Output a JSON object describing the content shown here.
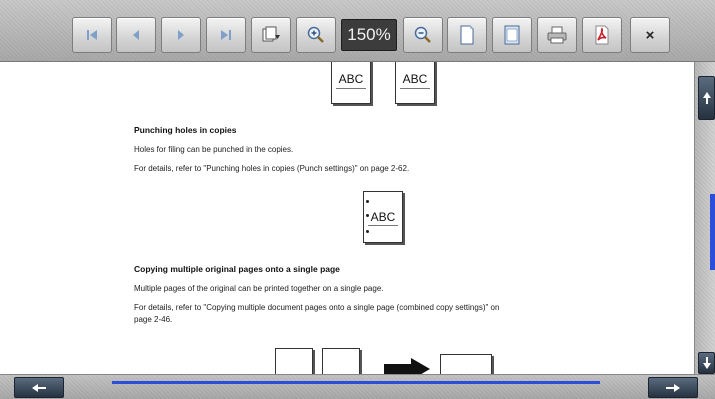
{
  "toolbar": {
    "buttons": [
      {
        "name": "first-page",
        "icon": "first-page-icon"
      },
      {
        "name": "previous-page",
        "icon": "previous-page-icon"
      },
      {
        "name": "next-page",
        "icon": "next-page-icon"
      },
      {
        "name": "last-page",
        "icon": "last-page-icon"
      },
      {
        "name": "page-select",
        "icon": "page-select-icon"
      },
      {
        "name": "zoom-in",
        "icon": "zoom-in-icon"
      },
      {
        "name": "zoom-out",
        "icon": "zoom-out-icon"
      },
      {
        "name": "fit-page",
        "icon": "fit-page-icon"
      },
      {
        "name": "fit-width",
        "icon": "fit-width-icon"
      },
      {
        "name": "print",
        "icon": "printer-icon"
      },
      {
        "name": "pdf",
        "icon": "pdf-icon"
      },
      {
        "name": "close",
        "icon": "close-icon"
      }
    ],
    "zoom_level": "150%",
    "close_label": "×"
  },
  "document": {
    "top_figure": {
      "left_box": "ABC",
      "right_box": "ABC"
    },
    "section1": {
      "heading": "Punching holes in copies",
      "line1": "Holes for filing can be punched in the copies.",
      "line2": "For details, refer to \"Punching holes in copies (Punch settings)\" on page 2-62.",
      "figure_text": "ABC"
    },
    "section2": {
      "heading": "Copying multiple original pages onto a single page",
      "line1": "Multiple pages of the original can be printed together on a single page.",
      "line2": "For details, refer to \"Copying multiple document pages onto a single page (combined copy settings)\" on",
      "line3": "page 2-46."
    }
  },
  "scrollbars": {
    "vertical": {
      "up_icon": "arrow-up-icon",
      "down_icon": "arrow-down-icon"
    },
    "horizontal": {
      "left_icon": "arrow-left-icon",
      "right_icon": "arrow-right-icon"
    }
  },
  "colors": {
    "accent_blue": "#2b4fd8",
    "zoom_display_bg": "#3c3c3c",
    "pdf_red": "#c8222b"
  }
}
